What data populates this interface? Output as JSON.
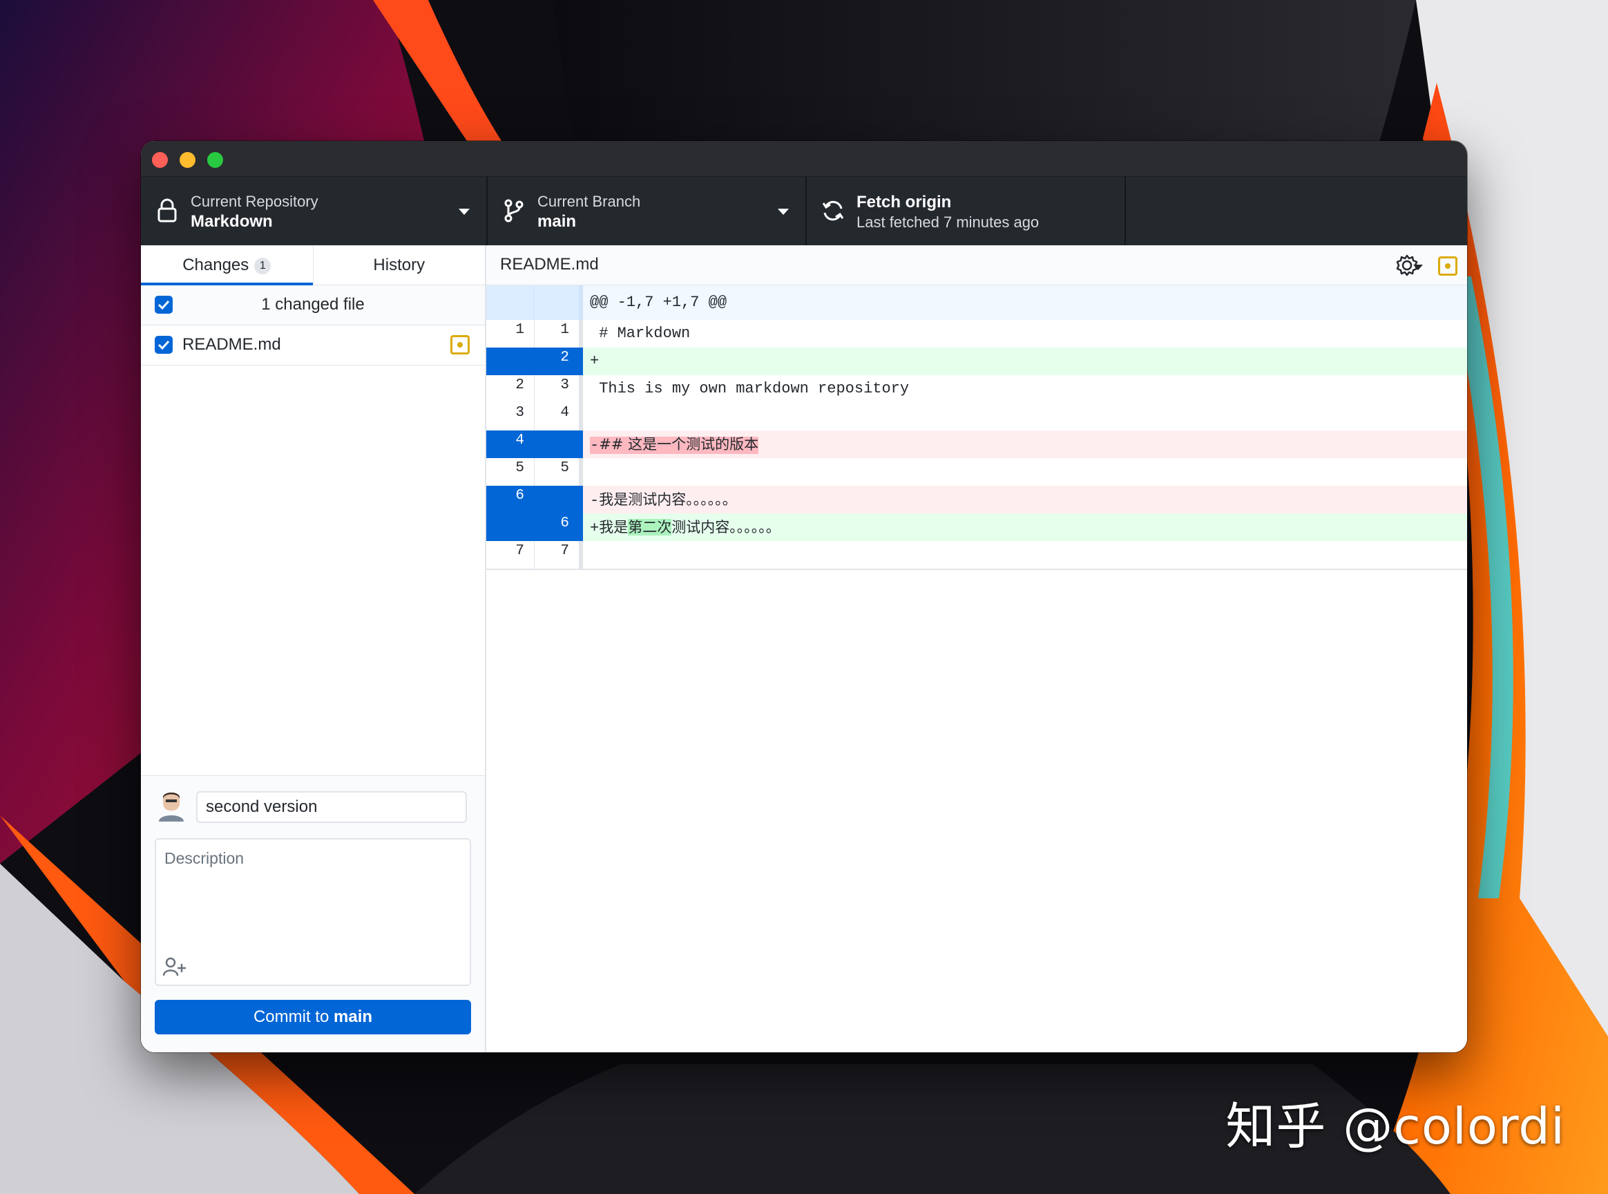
{
  "toolbar": {
    "repo_label": "Current Repository",
    "repo_value": "Markdown",
    "branch_label": "Current Branch",
    "branch_value": "main",
    "fetch_label": "Fetch origin",
    "fetch_value": "Last fetched 7 minutes ago"
  },
  "tabs": {
    "changes": "Changes",
    "changes_count": "1",
    "history": "History"
  },
  "changes": {
    "header": "1 changed file",
    "files": [
      {
        "name": "README.md"
      }
    ]
  },
  "commit": {
    "summary": "second version",
    "description_placeholder": "Description",
    "button_prefix": "Commit to",
    "button_branch": "main"
  },
  "diff": {
    "filename": "README.md",
    "hunk_header": "@@ -1,7 +1,7 @@",
    "lines": [
      {
        "old": "1",
        "new": "1",
        "text": " # Markdown"
      },
      {
        "old": "",
        "new": "2",
        "text": "+"
      },
      {
        "old": "2",
        "new": "3",
        "text": " This is my own markdown repository"
      },
      {
        "old": "3",
        "new": "4",
        "text": ""
      },
      {
        "old": "4",
        "new": "",
        "prefix": "-",
        "text": "## 这是一个测试的版本"
      },
      {
        "old": "5",
        "new": "5",
        "text": ""
      },
      {
        "old": "6",
        "new": "",
        "prefix": "-",
        "text": "我是测试内容。。。。。。"
      },
      {
        "old": "",
        "new": "6",
        "prefix": "+",
        "before": "我是",
        "highlight": "第二次",
        "after": "测试内容。。。。。。"
      },
      {
        "old": "7",
        "new": "7",
        "text": ""
      }
    ]
  },
  "watermark": "知乎 @colordi",
  "colors": {
    "accent": "#0366d6",
    "toolbar_bg": "#24292e",
    "added_bg": "#e6ffed",
    "deleted_bg": "#ffeef0",
    "modified": "#dbab09"
  },
  "icons": [
    "lock-icon",
    "branch-icon",
    "sync-icon",
    "checkbox-icon",
    "modified-file-icon",
    "gear-icon",
    "avatar-icon",
    "add-coauthor-icon"
  ]
}
